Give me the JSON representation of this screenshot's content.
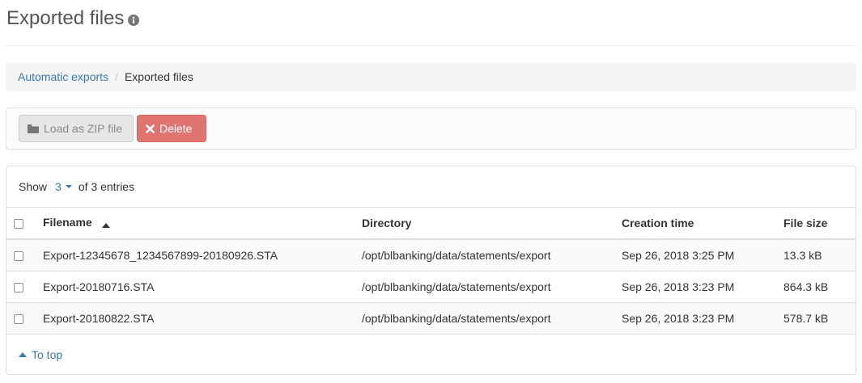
{
  "page": {
    "title": "Exported files"
  },
  "breadcrumb": {
    "items": [
      {
        "label": "Automatic exports"
      },
      {
        "label": "Exported files"
      }
    ],
    "separator": "/"
  },
  "toolbar": {
    "zip_label": "Load as ZIP file",
    "delete_label": "Delete"
  },
  "entries": {
    "show_label": "Show",
    "count": "3",
    "suffix": "of 3 entries"
  },
  "table": {
    "columns": [
      "Filename",
      "Directory",
      "Creation time",
      "File size"
    ],
    "rows": [
      {
        "filename": "Export-12345678_1234567899-20180926.STA",
        "directory": "/opt/blbanking/data/statements/export",
        "time": "Sep 26, 2018 3:25 PM",
        "size": "13.3 kB"
      },
      {
        "filename": "Export-20180716.STA",
        "directory": "/opt/blbanking/data/statements/export",
        "time": "Sep 26, 2018 3:23 PM",
        "size": "864.3 kB"
      },
      {
        "filename": "Export-20180822.STA",
        "directory": "/opt/blbanking/data/statements/export",
        "time": "Sep 26, 2018 3:23 PM",
        "size": "578.7 kB"
      }
    ]
  },
  "footer": {
    "to_top_label": "To top"
  },
  "colors": {
    "link": "#337ab7",
    "danger": "#d9534f",
    "title": "#555555"
  },
  "icons": {
    "info": "info-circle-icon",
    "zip": "folder-icon",
    "delete": "times-icon",
    "sort": "sort-asc-icon",
    "to_top": "triangle-up-icon"
  }
}
